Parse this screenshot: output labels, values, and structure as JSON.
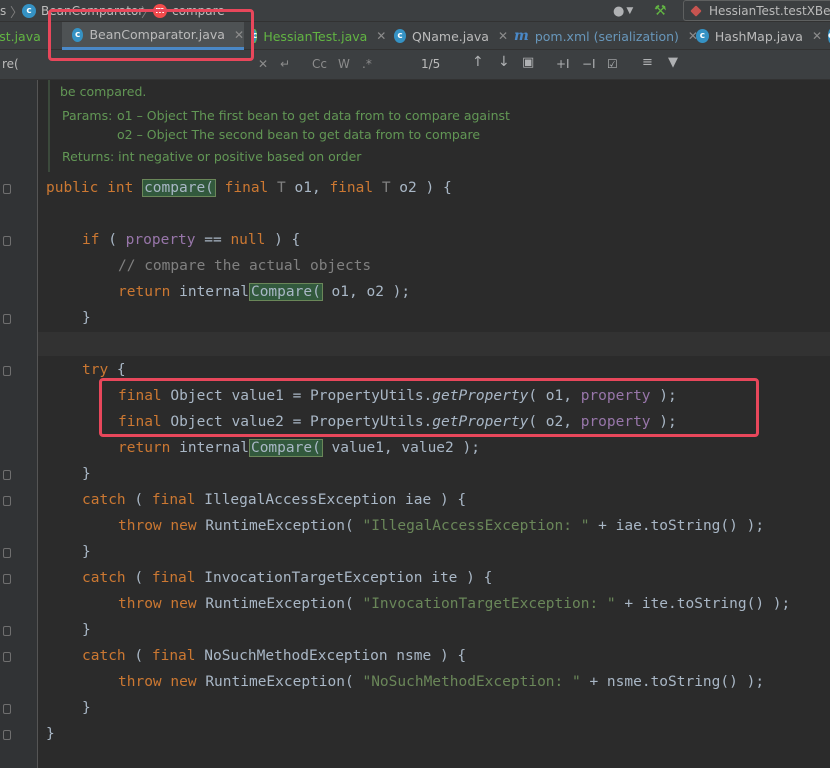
{
  "breadcrumb": {
    "items": [
      {
        "text": "s",
        "icon": "folder"
      },
      {
        "text": "BeanComparator",
        "icon": "class-icon"
      },
      {
        "text": "compare",
        "icon": "method-icon"
      }
    ]
  },
  "run_config": {
    "label": "HessianTest.testXBea"
  },
  "tabs": [
    {
      "label": "Test.java",
      "icon": "class-icon"
    },
    {
      "label": "BeanComparator.java",
      "icon": "class-icon",
      "active": true
    },
    {
      "label": "HessianTest.java",
      "icon": "class-icon"
    },
    {
      "label": "QName.java",
      "icon": "class-icon"
    },
    {
      "label": "pom.xml (serialization)",
      "icon": "maven-icon"
    },
    {
      "label": "HashMap.java",
      "icon": "class-icon"
    }
  ],
  "search": {
    "query": "re(",
    "match_case": "Cc",
    "words": "W",
    "match_count": "1/5"
  },
  "javadoc": {
    "line1": "be compared.",
    "params_label": "Params:",
    "param1": "o1 – Object The first bean to get data from to compare against",
    "param2": "o2 – Object The second bean to get data from to compare",
    "returns": "Returns: int negative or positive based on order"
  },
  "code": {
    "l1_kw1": "public",
    "l1_kw2": "int",
    "l1_method": "compare(",
    "l1_rest_a": " ",
    "l1_kw3": "final",
    "l1_T1": " T ",
    "l1_o1": "o1,",
    "l1_kw4": "final",
    "l1_T2": " T ",
    "l1_o2": "o2 ) {",
    "if_kw": "if",
    "if_open": " ( ",
    "if_field": "property",
    "if_op": " == ",
    "if_null": "null",
    "if_close": " ) {",
    "comment": "// compare the actual objects",
    "ret_kw": "return",
    "ret_internal": " internal",
    "ret_compare": "Compare(",
    "ret_args": " o1, o2 );",
    "brace": "}",
    "try_kw": "try",
    "try_open": " {",
    "final": "final",
    "v1_decl": " Object value1 = PropertyUtils.",
    "v2_decl": " Object value2 = PropertyUtils.",
    "getProperty": "getProperty",
    "v1_args_a": "( o1, ",
    "v2_args_a": "( o2, ",
    "prop": "property",
    "args_close": " );",
    "ret2_args": " value1, value2 );",
    "catch_kw": "catch",
    "c1_type": " IllegalAccessException iae ) {",
    "c2_type": " InvocationTargetException ite ) {",
    "c3_type": " NoSuchMethodException nsme ) {",
    "throw_kw": "throw",
    "new_kw": "new",
    "rte": " RuntimeException( ",
    "s1": "\"IllegalAccessException: \"",
    "s1_rest": " + iae.toString() );",
    "s2": "\"InvocationTargetException: \"",
    "s2_rest": " + ite.toString() );",
    "s3": "\"NoSuchMethodException: \"",
    "s3_rest": " + nsme.toString() );",
    "open_paren": " ( "
  }
}
